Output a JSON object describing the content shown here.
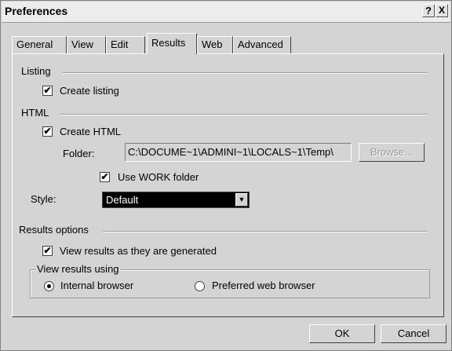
{
  "window": {
    "title": "Preferences",
    "help_label": "?",
    "close_label": "X"
  },
  "tabs": [
    {
      "label": "General"
    },
    {
      "label": "View"
    },
    {
      "label": "Edit"
    },
    {
      "label": "Results"
    },
    {
      "label": "Web"
    },
    {
      "label": "Advanced"
    }
  ],
  "active_tab": "Results",
  "listing": {
    "group_label": "Listing",
    "create_listing_label": "Create listing",
    "create_listing_checked": true
  },
  "html": {
    "group_label": "HTML",
    "create_html_label": "Create HTML",
    "create_html_checked": true,
    "folder_label": "Folder:",
    "folder_value": "C:\\DOCUME~1\\ADMINI~1\\LOCALS~1\\Temp\\",
    "browse_label": "Browse...",
    "use_work_label": "Use WORK folder",
    "use_work_checked": true,
    "style_label": "Style:",
    "style_value": "Default"
  },
  "results_options": {
    "group_label": "Results options",
    "view_results_label": "View results as they are generated",
    "view_results_checked": true,
    "view_using_label": "View results using",
    "internal_label": "Internal browser",
    "preferred_label": "Preferred web browser",
    "selected": "Internal browser"
  },
  "footer": {
    "ok_label": "OK",
    "cancel_label": "Cancel"
  },
  "check_glyph": "✔",
  "dropdown_glyph": "▼"
}
